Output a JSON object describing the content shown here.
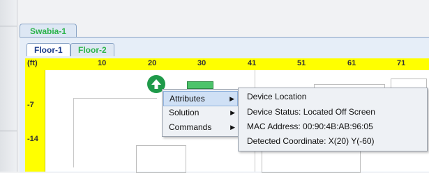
{
  "site": {
    "tab_label": "Swabia-1"
  },
  "floors": [
    {
      "label": "Floor-1",
      "active": true
    },
    {
      "label": "Floor-2",
      "active": false
    }
  ],
  "ruler": {
    "unit": "(ft)",
    "x_ticks": [
      "10",
      "20",
      "30",
      "41",
      "51",
      "61",
      "71"
    ],
    "y_ticks": [
      "-7",
      "-14"
    ]
  },
  "device": {
    "icon": "up-arrow-icon"
  },
  "context_menu": {
    "items": [
      {
        "label": "Attributes",
        "has_submenu": true,
        "highlighted": true
      },
      {
        "label": "Solution",
        "has_submenu": true,
        "highlighted": false
      },
      {
        "label": "Commands",
        "has_submenu": true,
        "highlighted": false
      }
    ],
    "submenu_arrow": "▶"
  },
  "attributes_submenu": {
    "items": [
      "Device Location",
      "Device Status: Located Off Screen",
      "MAC Address: 00:90:4B:AB:96:05",
      "Detected Coordinate: X(20) Y(-60)"
    ]
  },
  "colors": {
    "ruler_bg": "#ffff00",
    "floor_tab_green": "#2bb34a",
    "device_icon": "#1f9a4a",
    "highlight": "#cfe0f5"
  }
}
